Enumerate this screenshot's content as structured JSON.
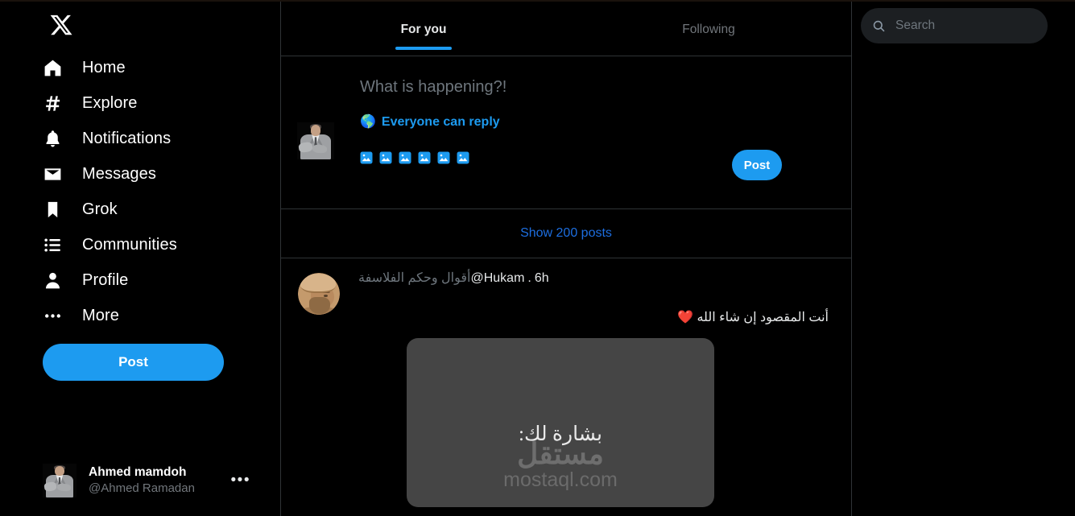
{
  "app": {
    "name": "X",
    "logo_icon": "x-logo-icon"
  },
  "sidebar": {
    "items": [
      {
        "label": "Home",
        "icon": "home-icon"
      },
      {
        "label": "Explore",
        "icon": "hash-icon"
      },
      {
        "label": "Notifications",
        "icon": "bell-icon"
      },
      {
        "label": "Messages",
        "icon": "envelope-icon"
      },
      {
        "label": "Grok",
        "icon": "bookmark-icon"
      },
      {
        "label": "Communities",
        "icon": "list-icon"
      },
      {
        "label": "Profile",
        "icon": "person-icon"
      },
      {
        "label": "More",
        "icon": "ellipsis-icon"
      }
    ],
    "post_button_label": "Post",
    "account": {
      "display_name": "Ahmed mamdoh",
      "handle": "@Ahmed Ramadan",
      "more_icon": "•••",
      "avatar_icon": "user-avatar"
    }
  },
  "feed": {
    "tabs": [
      {
        "label": "For you",
        "active": true
      },
      {
        "label": "Following",
        "active": false
      }
    ],
    "composer": {
      "avatar_icon": "user-avatar",
      "placeholder": "What is happening?!",
      "audience_label": "Everyone can reply",
      "audience_icon": "globe-icon",
      "tools": [
        "media-image-icon",
        "media-gif-icon",
        "media-poll-icon",
        "media-emoji-icon",
        "media-schedule-icon",
        "media-location-icon"
      ],
      "post_button_label": "Post"
    },
    "show_posts_label": "Show 200 posts",
    "tweet": {
      "avatar_icon": "philosopher-avatar",
      "author_name": "أقوال وحكم الفلاسفة",
      "handle": "@Hukam",
      "separator": ".",
      "timestamp": "6h",
      "body": "أنت المقصود إن شاء الله ❤️",
      "media": {
        "caption": "بشارة لك:",
        "watermark_ar": "مستقل",
        "watermark_latin": "mostaql.com"
      }
    }
  },
  "search": {
    "placeholder": "Search",
    "icon": "search-icon"
  },
  "colors": {
    "accent": "#1d9bf0",
    "link": "#1d6ee0",
    "background": "#000000",
    "border": "#2f3336",
    "muted_text": "#71767b",
    "primary_text": "#e7e9ea",
    "search_background": "#1c1f22",
    "media_background": "#454545"
  }
}
